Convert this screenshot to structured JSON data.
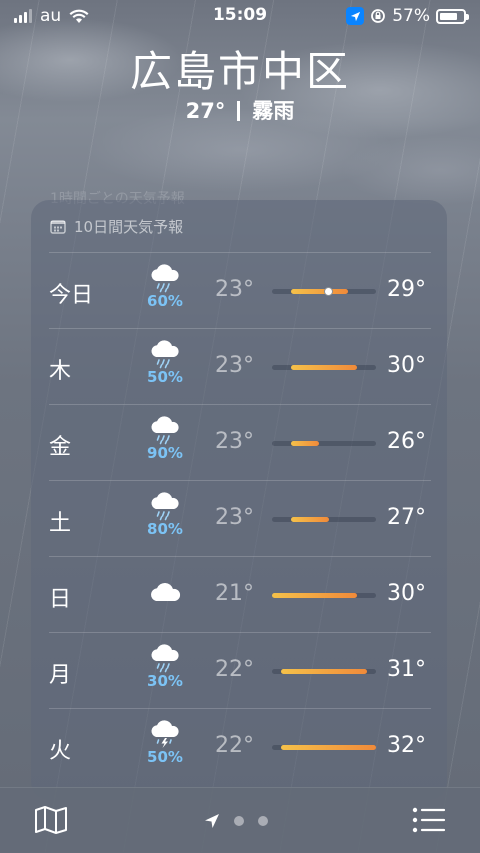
{
  "status": {
    "carrier": "au",
    "time": "15:09",
    "battery": "57%",
    "battery_level": 0.57
  },
  "location": {
    "city": "広島市中区",
    "temperature": "27°",
    "condition": "霧雨"
  },
  "background_hint": "1時間ごとの天気予報",
  "forecast": {
    "title": "10日間天気予報",
    "days": [
      {
        "day": "今日",
        "icon": "cloud-rain-icon",
        "precip": "60%",
        "low": "23°",
        "high": "29°",
        "low_value": 23,
        "high_value": 29,
        "current_value": 27
      },
      {
        "day": "木",
        "icon": "cloud-rain-icon",
        "precip": "50%",
        "low": "23°",
        "high": "30°",
        "low_value": 23,
        "high_value": 30
      },
      {
        "day": "金",
        "icon": "cloud-rain-icon",
        "precip": "90%",
        "low": "23°",
        "high": "26°",
        "low_value": 23,
        "high_value": 26
      },
      {
        "day": "土",
        "icon": "cloud-rain-icon",
        "precip": "80%",
        "low": "23°",
        "high": "27°",
        "low_value": 23,
        "high_value": 27
      },
      {
        "day": "日",
        "icon": "cloud-icon",
        "precip": "",
        "low": "21°",
        "high": "30°",
        "low_value": 21,
        "high_value": 30
      },
      {
        "day": "月",
        "icon": "cloud-rain-icon",
        "precip": "30%",
        "low": "22°",
        "high": "31°",
        "low_value": 22,
        "high_value": 31
      },
      {
        "day": "火",
        "icon": "cloud-bolt-icon",
        "precip": "50%",
        "low": "22°",
        "high": "32°",
        "low_value": 22,
        "high_value": 32
      }
    ]
  },
  "colors": {
    "precip": "#7cc3f5",
    "bar_start": "#f5c14a",
    "bar_end": "#f08a3a",
    "location_badge": "#0a84ff"
  },
  "toolbar": {
    "map_icon": "map-icon",
    "location_icon": "location-arrow-icon",
    "list_icon": "list-icon",
    "page_count": 3,
    "current_page": 0
  }
}
